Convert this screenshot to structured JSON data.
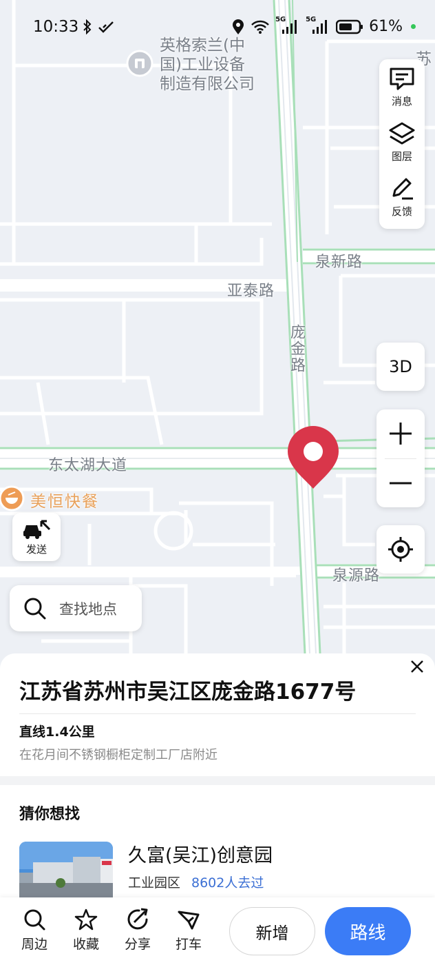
{
  "status_bar": {
    "time": "10:33",
    "signal_1": "5G",
    "signal_2": "5G",
    "battery": "61%"
  },
  "map": {
    "poi_company": "英格索兰(中国)工业设备制造有限公司",
    "poi_company_lines": [
      "英格索兰(中",
      "国)工业设备",
      "制造有限公司"
    ],
    "poi_right_edge": "苏",
    "poi_restaurant": "美恒快餐",
    "roads": {
      "quanxin": "泉新路",
      "yatai": "亚泰路",
      "pangjin": "庞金路",
      "dongtaihu": "东太湖大道",
      "quanyuan": "泉源路"
    }
  },
  "side_panel": {
    "messages": "消息",
    "layers": "图层",
    "feedback": "反馈"
  },
  "controls": {
    "three_d": "3D",
    "send": "发送"
  },
  "search": {
    "placeholder": "查找地点"
  },
  "place": {
    "address": "江苏省苏州市吴江区庞金路1677号",
    "distance": "直线1.4公里",
    "nearby": "在花月间不锈钢橱柜定制工厂店附近"
  },
  "recommendations": {
    "title": "猜你想找",
    "items": [
      {
        "name": "久富(吴江)创意园",
        "type": "工业园区",
        "visits": "8602人去过"
      }
    ]
  },
  "bottom_nav": {
    "nearby": "周边",
    "favorite": "收藏",
    "share": "分享",
    "taxi": "打车",
    "add_new": "新增",
    "route": "路线"
  },
  "colors": {
    "primary": "#3b7cf6",
    "pin": "#d9364a",
    "road_green": "#a8dfb8",
    "poi_orange": "#e8a15b",
    "link_blue": "#3b6fd4"
  }
}
